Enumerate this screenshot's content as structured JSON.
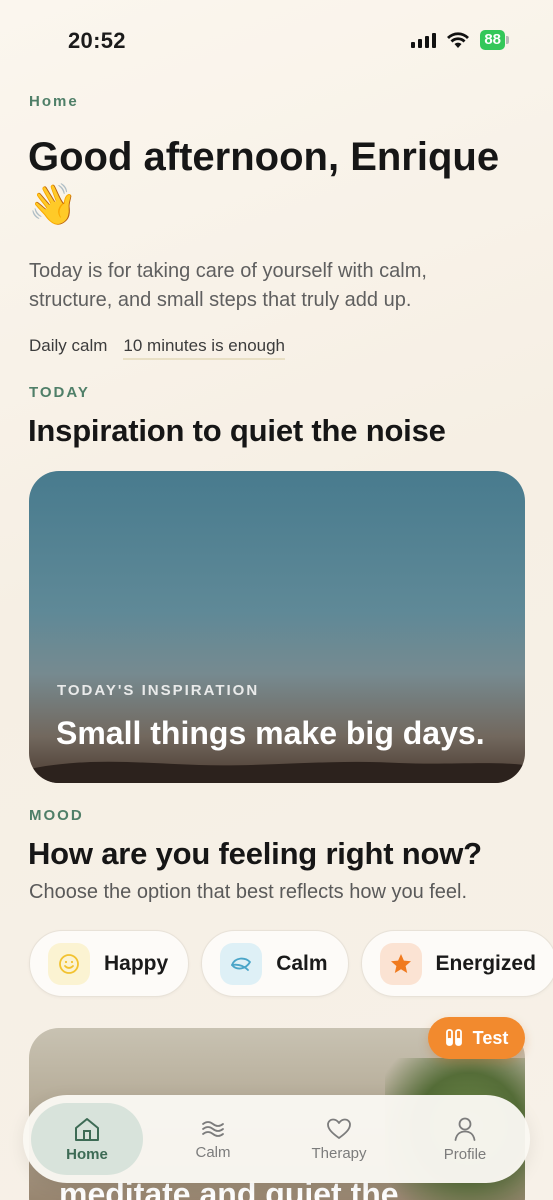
{
  "status": {
    "time": "20:52",
    "battery": "88"
  },
  "header": {
    "breadcrumb": "Home",
    "greeting": "Good afternoon, Enrique 👋",
    "intro": "Today is for taking care of yourself with calm, structure, and small steps that truly add up.",
    "daily_label": "Daily calm",
    "daily_value": "10 minutes is enough"
  },
  "today": {
    "eyebrow": "TODAY",
    "title": "Inspiration to quiet the noise",
    "card_label": "TODAY'S INSPIRATION",
    "card_quote": "Small things make big days."
  },
  "mood": {
    "eyebrow": "MOOD",
    "title": "How are you feeling right now?",
    "subtitle": "Choose the option that best reflects how you feel.",
    "options": [
      {
        "label": "Happy",
        "icon": "smile-icon",
        "color": "#f2c230"
      },
      {
        "label": "Calm",
        "icon": "leaf-icon",
        "color": "#4aa5c8"
      },
      {
        "label": "Energized",
        "icon": "star-icon",
        "color": "#f07a1e"
      }
    ]
  },
  "meditate_card": {
    "text": "meditate and quiet the"
  },
  "test_button": {
    "label": "Test"
  },
  "tabs": [
    {
      "label": "Home",
      "icon": "home-icon",
      "active": true
    },
    {
      "label": "Calm",
      "icon": "waves-icon",
      "active": false
    },
    {
      "label": "Therapy",
      "icon": "heart-icon",
      "active": false
    },
    {
      "label": "Profile",
      "icon": "person-icon",
      "active": false
    }
  ]
}
